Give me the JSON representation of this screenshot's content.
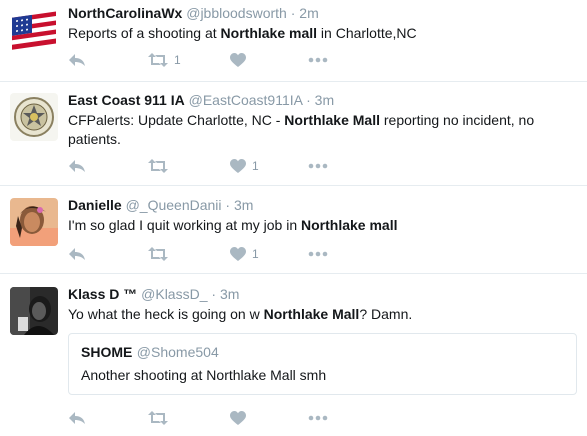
{
  "tweets": [
    {
      "name": "NorthCarolinaWx",
      "handle": "@jbbloodsworth",
      "dot": "·",
      "time": "2m",
      "text_parts": [
        "Reports of a shooting at ",
        "Northlake mall",
        " in Charlotte,NC"
      ],
      "retweets": "1",
      "likes": "",
      "avatar_icon": "us-flag-avatar"
    },
    {
      "name": "East Coast 911 IA",
      "handle": "@EastCoast911IA",
      "dot": "·",
      "time": "3m",
      "text_parts": [
        "CFPalerts: Update Charlotte, NC - ",
        "Northlake Mall",
        " reporting no incident, no patients."
      ],
      "retweets": "",
      "likes": "1",
      "avatar_icon": "emergency-badge-avatar"
    },
    {
      "name": "Danielle",
      "handle": "@_QueenDanii",
      "dot": "·",
      "time": "3m",
      "text_parts": [
        "I'm so glad I quit working at my job in ",
        "Northlake mall",
        ""
      ],
      "retweets": "",
      "likes": "1",
      "avatar_icon": "person-photo-avatar"
    },
    {
      "name": "Klass D ™",
      "handle": "@KlassD_",
      "dot": "·",
      "time": "3m",
      "text_parts": [
        "Yo what the heck is going on w ",
        "Northlake Mall",
        "? Damn."
      ],
      "retweets": "",
      "likes": "",
      "avatar_icon": "bw-photo-avatar",
      "quote": {
        "name": "SHOME",
        "handle": "@Shome504",
        "text": "Another shooting at Northlake Mall smh"
      }
    }
  ],
  "icons": {
    "reply": "reply-icon",
    "retweet": "retweet-icon",
    "like": "heart-icon",
    "more": "more-icon"
  },
  "colors": {
    "icon_gray": "#aab8c2",
    "meta_gray": "#8899a6",
    "divider": "#e6ecf0"
  }
}
